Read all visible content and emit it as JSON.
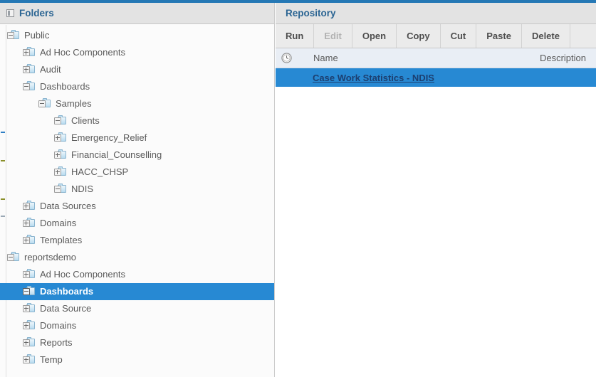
{
  "theme": {
    "accent_blue": "#2578b5",
    "selection_blue": "#2789d3",
    "title_text": "#2b6593",
    "panel_header_bg": "#e3e3e3",
    "toolbar_bg": "#ebebeb",
    "column_header_bg": "#e9eef5",
    "link_navy": "#1c3f70",
    "tree_text": "#5a5a5a",
    "disabled_text": "#b2b2b2"
  },
  "left_panel": {
    "title": "Folders",
    "collapse_icon": "panel-collapse-icon",
    "tree": [
      {
        "label": "Public",
        "depth": 0,
        "state": "expanded"
      },
      {
        "label": "Ad Hoc Components",
        "depth": 1,
        "state": "collapsed"
      },
      {
        "label": "Audit",
        "depth": 1,
        "state": "collapsed"
      },
      {
        "label": "Dashboards",
        "depth": 1,
        "state": "expanded"
      },
      {
        "label": "Samples",
        "depth": 2,
        "state": "expanded"
      },
      {
        "label": "Clients",
        "depth": 3,
        "state": "expanded"
      },
      {
        "label": "Emergency_Relief",
        "depth": 3,
        "state": "collapsed"
      },
      {
        "label": "Financial_Counselling",
        "depth": 3,
        "state": "collapsed"
      },
      {
        "label": "HACC_CHSP",
        "depth": 3,
        "state": "collapsed"
      },
      {
        "label": "NDIS",
        "depth": 3,
        "state": "expanded"
      },
      {
        "label": "Data Sources",
        "depth": 1,
        "state": "collapsed"
      },
      {
        "label": "Domains",
        "depth": 1,
        "state": "collapsed"
      },
      {
        "label": "Templates",
        "depth": 1,
        "state": "collapsed"
      },
      {
        "label": "reportsdemo",
        "depth": 0,
        "state": "expanded"
      },
      {
        "label": "Ad Hoc Components",
        "depth": 1,
        "state": "collapsed"
      },
      {
        "label": "Dashboards",
        "depth": 1,
        "state": "expanded",
        "selected": true
      },
      {
        "label": "Data Source",
        "depth": 1,
        "state": "collapsed"
      },
      {
        "label": "Domains",
        "depth": 1,
        "state": "collapsed"
      },
      {
        "label": "Reports",
        "depth": 1,
        "state": "collapsed"
      },
      {
        "label": "Temp",
        "depth": 1,
        "state": "collapsed"
      }
    ]
  },
  "right_panel": {
    "title": "Repository",
    "toolbar": [
      {
        "label": "Run",
        "enabled": true
      },
      {
        "label": "Edit",
        "enabled": false
      },
      {
        "label": "Open",
        "enabled": true
      },
      {
        "label": "Copy",
        "enabled": true
      },
      {
        "label": "Cut",
        "enabled": true
      },
      {
        "label": "Paste",
        "enabled": true
      },
      {
        "label": "Delete",
        "enabled": true
      }
    ],
    "columns": {
      "schedule_icon": "clock-icon",
      "name": "Name",
      "description": "Description"
    },
    "rows": [
      {
        "name": "Case Work Statistics - NDIS",
        "description": "",
        "selected": true
      }
    ]
  }
}
